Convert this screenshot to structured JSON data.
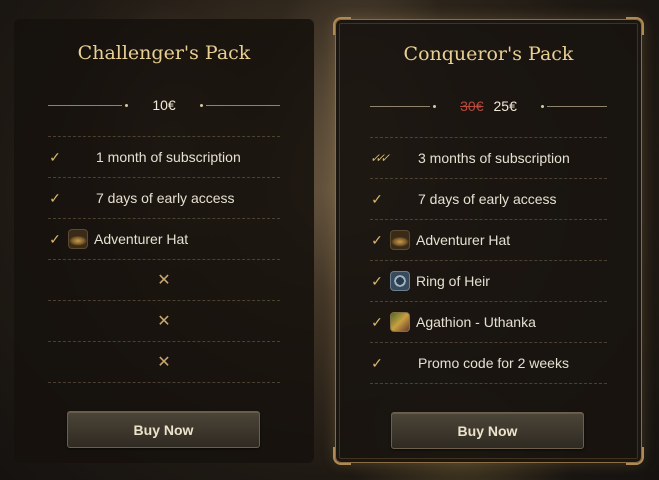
{
  "packs": [
    {
      "title": "Challenger's Pack",
      "price": "10€",
      "rows": [
        {
          "check": "✓",
          "label": "1 month of subscription"
        },
        {
          "check": "✓",
          "label": "7 days of early access"
        },
        {
          "check": "✓",
          "label": "Adventurer Hat",
          "icon": "hat-icon"
        },
        {
          "cross": "✕"
        },
        {
          "cross": "✕"
        },
        {
          "cross": "✕"
        }
      ],
      "buy_label": "Buy Now"
    },
    {
      "title": "Conqueror's Pack",
      "old_price": "30€",
      "price": "25€",
      "rows": [
        {
          "check": "✓✓✓",
          "label": "3 months of subscription"
        },
        {
          "check": "✓",
          "label": "7 days of early access"
        },
        {
          "check": "✓",
          "label": "Adventurer Hat",
          "icon": "hat-icon"
        },
        {
          "check": "✓",
          "label": "Ring of Heir",
          "icon": "ring-icon"
        },
        {
          "check": "✓",
          "label": "Agathion - Uthanka",
          "icon": "agathion-icon"
        },
        {
          "check": "✓",
          "label": "Promo code for 2 weeks"
        }
      ],
      "buy_label": "Buy Now"
    }
  ],
  "colors": {
    "title": "#e8cf93",
    "check": "#d8b66e",
    "old_price": "#b84a40",
    "highlight_border": "#8a6d45"
  }
}
